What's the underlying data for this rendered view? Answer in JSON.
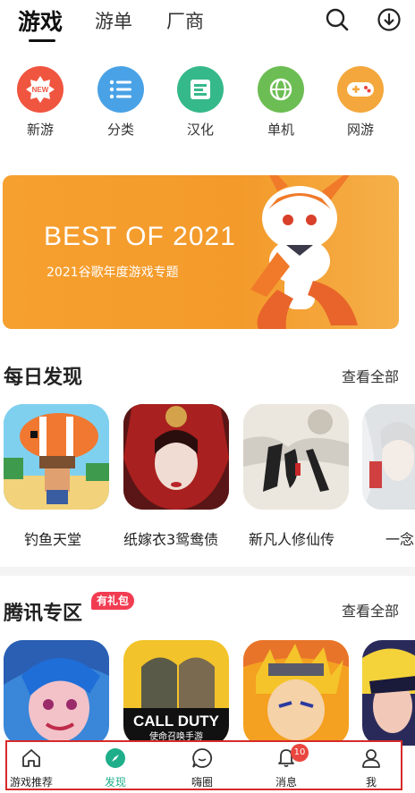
{
  "top_nav": {
    "tabs": [
      {
        "label": "游戏",
        "active": true
      },
      {
        "label": "游单",
        "active": false
      },
      {
        "label": "厂商",
        "active": false
      }
    ],
    "icons": [
      "search-icon",
      "download-icon"
    ]
  },
  "categories": [
    {
      "label": "新游",
      "icon": "new-badge-icon",
      "color": "#f0553f"
    },
    {
      "label": "分类",
      "icon": "list-icon",
      "color": "#4aa2e6"
    },
    {
      "label": "汉化",
      "icon": "translate-icon",
      "color": "#36b98a"
    },
    {
      "label": "单机",
      "icon": "globe-icon",
      "color": "#6cbd53"
    },
    {
      "label": "网游",
      "icon": "gamepad-icon",
      "color": "#f4a73c"
    }
  ],
  "banner": {
    "title": "BEST OF 2021",
    "subtitle": "2021谷歌年度游戏专题"
  },
  "daily": {
    "title": "每日发现",
    "more": "查看全部",
    "apps": [
      {
        "name": "钓鱼天堂"
      },
      {
        "name": "纸嫁衣3鸳鸯债"
      },
      {
        "name": "新凡人修仙传"
      },
      {
        "name": "一念"
      }
    ]
  },
  "tencent": {
    "title": "腾讯专区",
    "badge": "有礼包",
    "more": "查看全部",
    "apps": [
      {
        "name": ""
      },
      {
        "name": ""
      },
      {
        "name": ""
      },
      {
        "name": ""
      }
    ],
    "tile_texts": {
      "cod": "CALL DUTY",
      "cod_sub": "使命召唤手游"
    }
  },
  "bottom_nav": {
    "items": [
      {
        "label": "游戏推荐",
        "icon": "home-icon"
      },
      {
        "label": "发现",
        "icon": "compass-icon",
        "active": true
      },
      {
        "label": "嗨圈",
        "icon": "chat-bubble-icon"
      },
      {
        "label": "消息",
        "icon": "bell-icon",
        "badge": "10"
      },
      {
        "label": "我",
        "icon": "user-icon"
      }
    ]
  },
  "colors": {
    "accent": "#1fae8a",
    "banner": "#f39a2a",
    "badge_red": "#f23c52",
    "highlight_box": "#d62a2a"
  }
}
